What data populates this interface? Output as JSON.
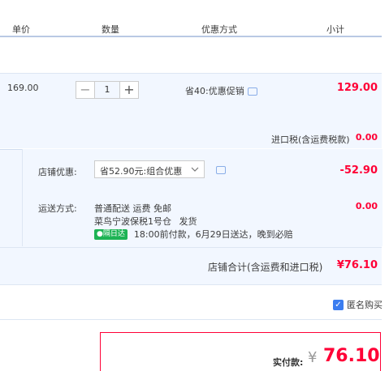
{
  "header": {
    "unit_price": "单价",
    "quantity": "数量",
    "discount_method": "优惠方式",
    "subtotal": "小计"
  },
  "item": {
    "unit_price": "169.00",
    "quantity": "1",
    "minus": "−",
    "plus": "+",
    "promo": "省40:优惠促销",
    "subtotal": "129.00"
  },
  "import_tax": {
    "label": "进口税(含运费税款)",
    "value": "0.00"
  },
  "shop_discount": {
    "label": "店铺优惠:",
    "selected": "省52.90元:组合优惠",
    "value": "-52.90"
  },
  "shipping": {
    "label": "运送方式:",
    "method": "普通配送 运费 免邮",
    "warehouse": "菜鸟宁波保税1号仓",
    "dispatch": "发货",
    "badge": "隔日达",
    "note": "18:00前付款，6月29日送达，晚到必赔",
    "value": "0.00"
  },
  "shop_total": {
    "label": "店铺合计(含运费和进口税)",
    "value": "¥76.10"
  },
  "anonymous": {
    "label": "匿名购买",
    "checked": true
  },
  "payment": {
    "label": "实付款:",
    "currency": "¥",
    "amount": "76.10"
  },
  "colors": {
    "accent_red": "#ff0036",
    "panel_blue": "#f2f7ff",
    "badge_green": "#1db354"
  }
}
